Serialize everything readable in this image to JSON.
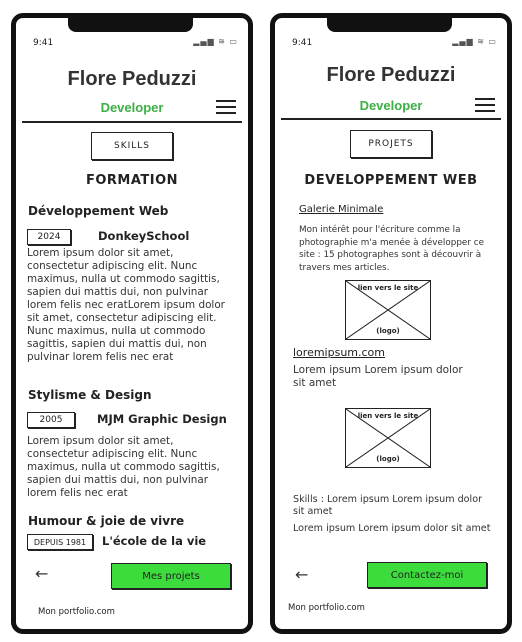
{
  "status": {
    "time": "9:41",
    "icons": "▂▄▆ ≋ ▭"
  },
  "profile": {
    "name": "Flore Peduzzi",
    "role": "Developer"
  },
  "left": {
    "section_button": "SKILLS",
    "section_title": "FORMATION",
    "category1": "Développement Web",
    "entry1": {
      "year": "2024",
      "school": "DonkeySchool",
      "text": "Lorem ipsum dolor sit amet, consectetur adipiscing elit. Nunc maximus, nulla ut commodo sagittis, sapien dui mattis dui, non pulvinar lorem felis nec eratLorem ipsum dolor sit amet, consectetur adipiscing elit. Nunc maximus, nulla ut commodo sagittis, sapien dui mattis dui, non pulvinar lorem felis nec erat"
    },
    "category2": "Stylisme & Design",
    "entry2": {
      "year": "2005",
      "school": "MJM Graphic Design",
      "text": "Lorem ipsum dolor sit amet, consectetur adipiscing elit. Nunc maximus, nulla ut commodo sagittis, sapien dui mattis dui, non pulvinar lorem felis nec erat"
    },
    "category3": "Humour & joie de vivre",
    "entry3": {
      "year": "DEPUIS 1981",
      "school": "L'école de la vie"
    },
    "cta": "Mes projets",
    "footer": "Mon portfolio.com"
  },
  "right": {
    "section_button": "PROJETS",
    "section_title": "DEVELOPPEMENT WEB",
    "gallery_link": "Galerie Minimale",
    "gallery_text": "Mon intérêt pour l'écriture comme la photographie m'a menée à développer ce site : 15 photographes sont à découvrir à travers mes articles.",
    "placeholder": {
      "top": "lien vers le site",
      "bottom": "(logo)"
    },
    "project2_link": "loremipsum.com",
    "project2_text": "Lorem ipsum Lorem ipsum dolor sit amet",
    "skills_text": "Skills : Lorem ipsum Lorem ipsum dolor sit amet",
    "more_text": "Lorem ipsum Lorem ipsum dolor sit amet",
    "cta": "Contactez-moi",
    "footer": "Mon portfolio.com"
  },
  "icons": {
    "back": "arrow-left",
    "menu": "hamburger"
  },
  "colors": {
    "accent": "#3cb043",
    "cta": "#3ddc3d"
  }
}
